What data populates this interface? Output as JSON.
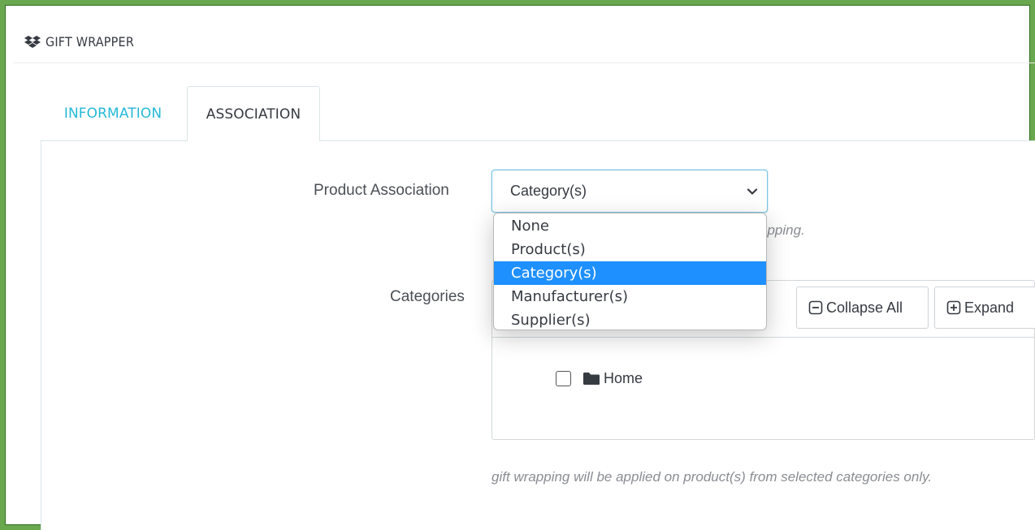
{
  "panel": {
    "title": "GIFT WRAPPER",
    "icon": "dropbox-icon"
  },
  "tabs": [
    {
      "label": "INFORMATION",
      "active": false
    },
    {
      "label": "ASSOCIATION",
      "active": true
    }
  ],
  "form": {
    "product_association": {
      "label": "Product Association",
      "selected": "Category(s)",
      "options": [
        "None",
        "Product(s)",
        "Category(s)",
        "Manufacturer(s)",
        "Supplier(s)"
      ],
      "help_visible": "apping."
    },
    "categories": {
      "label": "Categories",
      "collapse_all": "Collapse All",
      "expand_all": "Expand",
      "tree": [
        {
          "label": "Home",
          "checked": false
        }
      ],
      "help": "gift wrapping will be applied on product(s) from selected categories only."
    }
  },
  "colors": {
    "accent": "#25b9d7",
    "selected_option": "#1e90ff",
    "frame": "#6aa84f"
  }
}
